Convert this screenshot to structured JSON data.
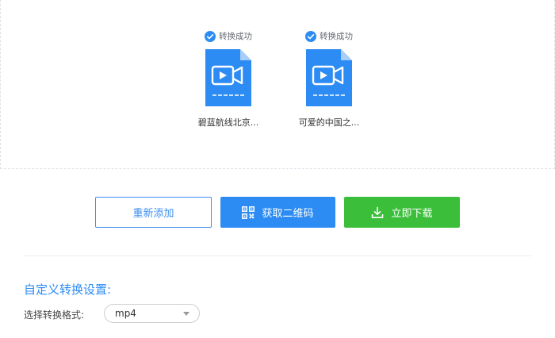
{
  "files": [
    {
      "status": "转换成功",
      "name": "碧蓝航线北京...",
      "icon": "video-file-icon"
    },
    {
      "status": "转换成功",
      "name": "可爱的中国之...",
      "icon": "video-file-icon"
    }
  ],
  "actions": {
    "readd_label": "重新添加",
    "qrcode_label": "获取二维码",
    "download_label": "立即下载"
  },
  "settings": {
    "title": "自定义转换设置:",
    "format_label": "选择转换格式:",
    "format_value": "mp4"
  },
  "colors": {
    "accent_blue": "#2c8cf4",
    "success_green": "#3bbf3b",
    "check_blue": "#2c8cf4"
  }
}
